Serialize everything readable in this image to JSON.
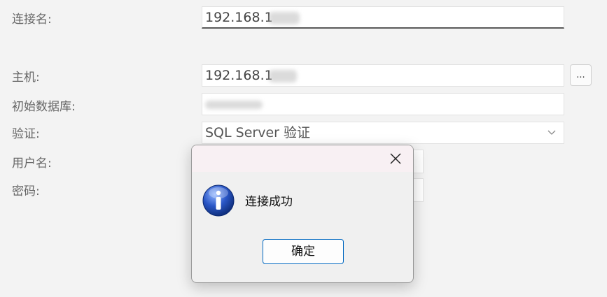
{
  "form": {
    "connection_name": {
      "label": "连接名:",
      "value": "192.168.1"
    },
    "host": {
      "label": "主机:",
      "value": "192.168.1",
      "browse_label": "..."
    },
    "initial_database": {
      "label": "初始数据库:",
      "value": ""
    },
    "authentication": {
      "label": "验证:",
      "value": "SQL Server 验证"
    },
    "username": {
      "label": "用户名:"
    },
    "password": {
      "label": "密码:"
    }
  },
  "dialog": {
    "message": "连接成功",
    "ok_label": "确定",
    "icon": "info-icon",
    "close_icon": "close-icon"
  },
  "colors": {
    "accent": "#0067c0",
    "info_icon_blue": "#1f4fb7",
    "background": "#f3f3f3"
  }
}
